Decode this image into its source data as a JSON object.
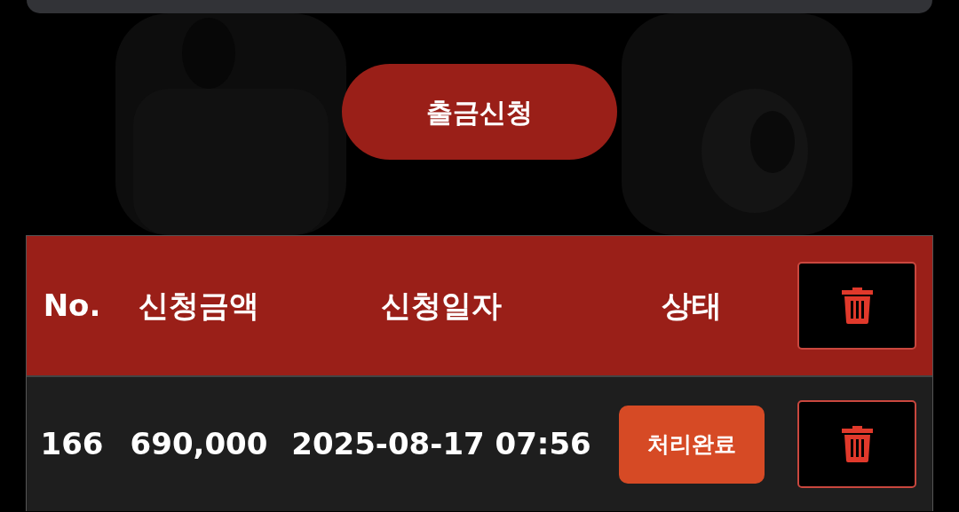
{
  "withdraw_button": {
    "label": "출금신청"
  },
  "table": {
    "columns": [
      "No.",
      "신청금액",
      "신청일자",
      "상태"
    ],
    "rows": [
      {
        "no": "166",
        "amount": "690,000",
        "date": "2025-08-17 07:56",
        "status": {
          "label": "처리완료",
          "kind": "done"
        }
      }
    ]
  }
}
